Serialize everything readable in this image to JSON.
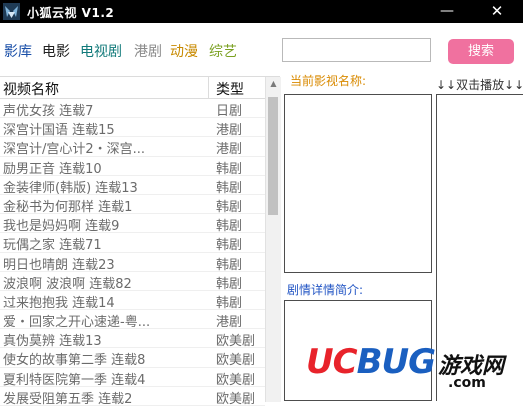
{
  "window": {
    "title": "小狐云视 V1.2",
    "minimize_label": "—",
    "close_label": "✕"
  },
  "nav": [
    {
      "label": "影库",
      "color": "#1a4fa8"
    },
    {
      "label": "电影",
      "color": "#222222"
    },
    {
      "label": "电视剧",
      "color": "#117a7a"
    },
    {
      "label": "港剧",
      "color": "#8a8a8a"
    },
    {
      "label": "动漫",
      "color": "#c88a00"
    },
    {
      "label": "综艺",
      "color": "#7aa020"
    }
  ],
  "search": {
    "value": "",
    "button_label": "搜索"
  },
  "list": {
    "headers": {
      "name": "视频名称",
      "type": "类型"
    },
    "rows": [
      {
        "name": "声优女孩 连载7",
        "type": "日剧"
      },
      {
        "name": "深宫计国语 连载15",
        "type": "港剧"
      },
      {
        "name": "深宫计/宫心计2・深宫...",
        "type": "港剧"
      },
      {
        "name": "励男正音 连载10",
        "type": "韩剧"
      },
      {
        "name": "金装律师(韩版) 连载13",
        "type": "韩剧"
      },
      {
        "name": "金秘书为何那样 连载1",
        "type": "韩剧"
      },
      {
        "name": "我也是妈妈啊 连载9",
        "type": "韩剧"
      },
      {
        "name": "玩偶之家 连载71",
        "type": "韩剧"
      },
      {
        "name": "明日也晴朗 连载23",
        "type": "韩剧"
      },
      {
        "name": "波浪啊 波浪啊 连载82",
        "type": "韩剧"
      },
      {
        "name": "过来抱抱我 连载14",
        "type": "韩剧"
      },
      {
        "name": "爱・回家之开心速递-粤...",
        "type": "港剧"
      },
      {
        "name": "真伪莫辨 连载13",
        "type": "欧美剧"
      },
      {
        "name": "使女的故事第二季 连载8",
        "type": "欧美剧"
      },
      {
        "name": "夏利特医院第一季 连载4",
        "type": "欧美剧"
      },
      {
        "name": "发展受阻第五季 连载2",
        "type": "欧美剧"
      }
    ]
  },
  "panels": {
    "current_label": "当前影视名称:",
    "plot_label": "剧情详情简介:",
    "play_label": "↓↓双击播放↓↓"
  },
  "watermark": {
    "logo_uc": "UC",
    "logo_bug": "BUG",
    "cn": "游戏网",
    "com": ".com"
  },
  "icons": {
    "app": "fox-logo-icon",
    "scroll_up": "triangle-up-icon"
  }
}
